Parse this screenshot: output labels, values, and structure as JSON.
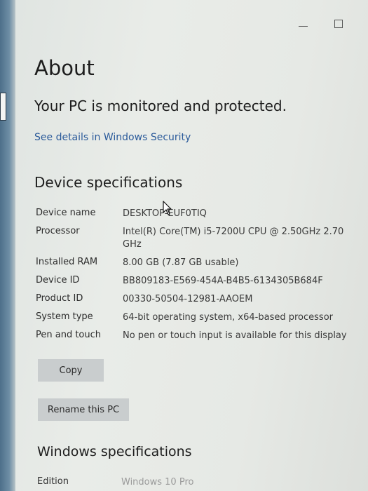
{
  "window": {
    "title": "About"
  },
  "security": {
    "status": "Your PC is monitored and protected.",
    "link_label": "See details in Windows Security"
  },
  "device_specs": {
    "title": "Device specifications",
    "rows": [
      {
        "label": "Device name",
        "value": "DESKTOP-EUF0TIQ"
      },
      {
        "label": "Processor",
        "value": "Intel(R) Core(TM) i5-7200U CPU @ 2.50GHz   2.70 GHz"
      },
      {
        "label": "Installed RAM",
        "value": "8.00 GB (7.87 GB usable)"
      },
      {
        "label": "Device ID",
        "value": "BB809183-E569-454A-B4B5-6134305B684F"
      },
      {
        "label": "Product ID",
        "value": "00330-50504-12981-AAOEM"
      },
      {
        "label": "System type",
        "value": "64-bit operating system, x64-based processor"
      },
      {
        "label": "Pen and touch",
        "value": "No pen or touch input is available for this display"
      }
    ],
    "copy_label": "Copy",
    "rename_label": "Rename this PC"
  },
  "windows_specs": {
    "title": "Windows specifications",
    "edition_label": "Edition",
    "edition_value": "Windows 10 Pro"
  },
  "icons": {
    "minimize": "minimize-icon",
    "maximize": "maximize-icon",
    "cursor": "mouse-cursor-icon"
  }
}
